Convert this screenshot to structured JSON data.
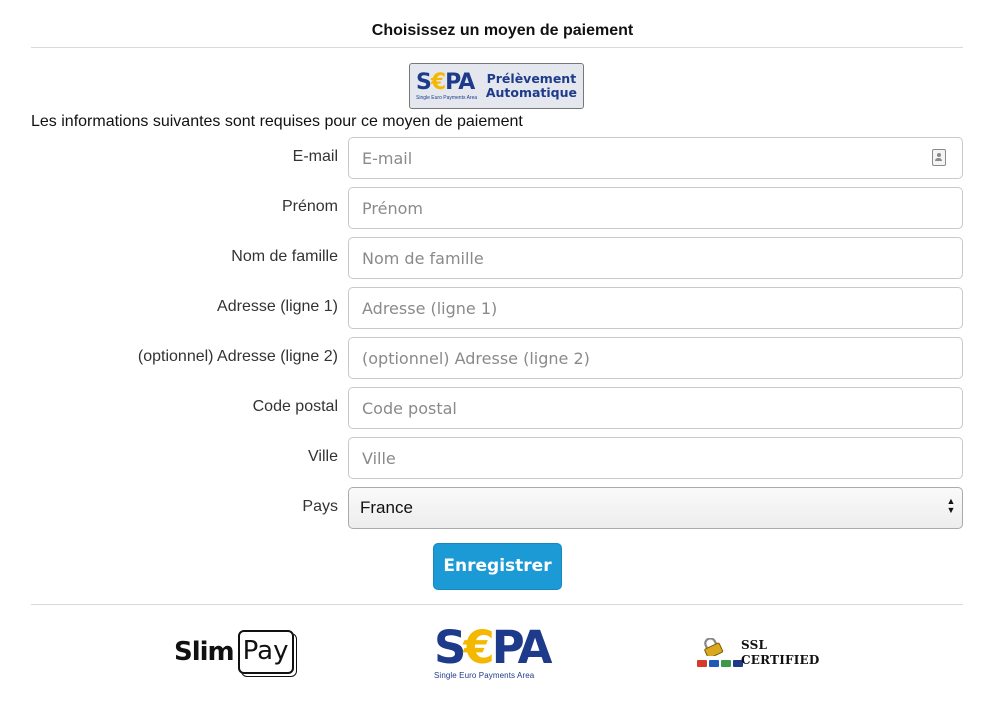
{
  "header": {
    "title": "Choisissez un moyen de paiement"
  },
  "payment_method": {
    "sepa_word_prefix": "S",
    "sepa_word_e": "€",
    "sepa_word_suffix": "PA",
    "sepa_subtitle": "Single Euro Payments Area",
    "method_line1": "Prélèvement",
    "method_line2": "Automatique"
  },
  "form": {
    "intro": "Les informations suivantes sont requises pour ce moyen de paiement",
    "fields": [
      {
        "label": "E-mail",
        "placeholder": "E-mail",
        "value": ""
      },
      {
        "label": "Prénom",
        "placeholder": "Prénom",
        "value": ""
      },
      {
        "label": "Nom de famille",
        "placeholder": "Nom de famille",
        "value": ""
      },
      {
        "label": "Adresse (ligne 1)",
        "placeholder": "Adresse (ligne 1)",
        "value": ""
      },
      {
        "label": "(optionnel) Adresse (ligne 2)",
        "placeholder": "(optionnel) Adresse (ligne 2)",
        "value": ""
      },
      {
        "label": "Code postal",
        "placeholder": "Code postal",
        "value": ""
      },
      {
        "label": "Ville",
        "placeholder": "Ville",
        "value": ""
      }
    ],
    "country": {
      "label": "Pays",
      "selected": "France"
    },
    "submit_label": "Enregistrer"
  },
  "footer": {
    "slimpay_slim": "Slim",
    "slimpay_pay": "Pay",
    "sepa_word_prefix": "S",
    "sepa_word_e": "€",
    "sepa_word_suffix": "PA",
    "sepa_subtitle": "Single Euro Payments Area",
    "ssl_line1": "SSL",
    "ssl_line2": "CERTIFIED"
  },
  "colors": {
    "accent_button": "#1c9ad6",
    "sepa_blue": "#1e3a8a",
    "sepa_yellow": "#f5b800"
  }
}
